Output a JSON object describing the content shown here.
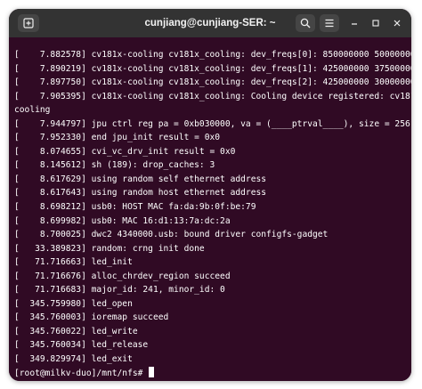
{
  "window": {
    "title": "cunjiang@cunjiang-SER: ~"
  },
  "header": {
    "new_tab_icon": "new-tab-icon",
    "search_icon": "search-icon",
    "menu_icon": "hamburger-menu-icon",
    "minimize_icon": "minimize-icon",
    "maximize_icon": "maximize-icon",
    "close_icon": "close-icon"
  },
  "terminal": {
    "background": "#300a24",
    "foreground": "#ffffff",
    "lines": [
      "[    7.882578] cv181x-cooling cv181x_cooling: dev_freqs[0]: 850000000 500000000",
      "[    7.890219] cv181x-cooling cv181x_cooling: dev_freqs[1]: 425000000 375000000",
      "[    7.897750] cv181x-cooling cv181x_cooling: dev_freqs[2]: 425000000 300000000",
      "[    7.905395] cv181x-cooling cv181x_cooling: Cooling device registered: cv181x_",
      "cooling",
      "[    7.944797] jpu ctrl reg pa = 0xb030000, va = (____ptrval____), size = 256",
      "[    7.952330] end jpu_init result = 0x0",
      "[    8.074655] cvi_vc_drv_init result = 0x0",
      "[    8.145612] sh (189): drop_caches: 3",
      "[    8.617629] using random self ethernet address",
      "[    8.617643] using random host ethernet address",
      "[    8.698212] usb0: HOST MAC fa:da:9b:0f:be:79",
      "[    8.699982] usb0: MAC 16:d1:13:7a:dc:2a",
      "[    8.700025] dwc2 4340000.usb: bound driver configfs-gadget",
      "[   33.389823] random: crng init done",
      "[   71.716663] led_init",
      "[   71.716676] alloc_chrdev_region succeed",
      "[   71.716683] major_id: 241, minor_id: 0",
      "[  345.759980] led_open",
      "[  345.760003] ioremap succeed",
      "[  345.760022] led_write",
      "[  345.760034] led_release",
      "[  349.829974] led_exit"
    ],
    "prompt": "[root@milkv-duo]/mnt/nfs# "
  }
}
